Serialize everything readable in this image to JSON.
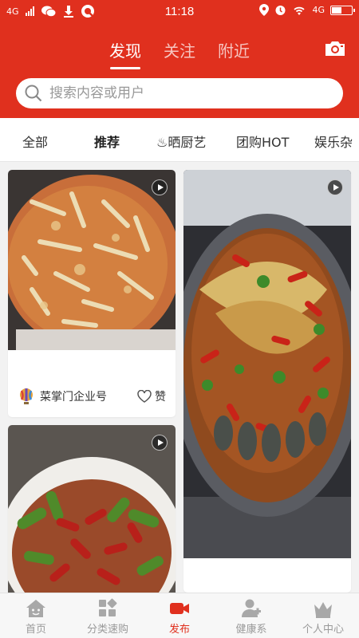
{
  "status_bar": {
    "time": "11:18",
    "network_left": "4G",
    "network_right": "4G"
  },
  "header": {
    "tabs": [
      {
        "label": "发现",
        "active": true
      },
      {
        "label": "关注",
        "active": false
      },
      {
        "label": "附近",
        "active": false
      }
    ],
    "camera_icon": "camera-icon"
  },
  "search": {
    "placeholder": "搜索内容或用户"
  },
  "categories": [
    {
      "label": "全部",
      "active": false
    },
    {
      "label": "推荐",
      "active": true
    },
    {
      "label": "♨晒厨艺",
      "active": false
    },
    {
      "label": "团购HOT",
      "active": false
    },
    {
      "label": "娱乐杂",
      "active": false
    }
  ],
  "feed": {
    "cards": [
      {
        "author": "菜掌门企业号",
        "like_label": "赞",
        "has_video": true
      },
      {
        "has_video": true
      },
      {
        "has_video": true
      }
    ]
  },
  "bottom_nav": [
    {
      "label": "首页",
      "icon": "home-icon",
      "active": false
    },
    {
      "label": "分类速购",
      "icon": "category-icon",
      "active": false
    },
    {
      "label": "发布",
      "icon": "video-camera-icon",
      "active": true
    },
    {
      "label": "健康系",
      "icon": "health-person-icon",
      "active": false
    },
    {
      "label": "个人中心",
      "icon": "crown-icon",
      "active": false
    }
  ],
  "colors": {
    "brand": "#e0301e",
    "nav_inactive": "#9a9a9a"
  }
}
